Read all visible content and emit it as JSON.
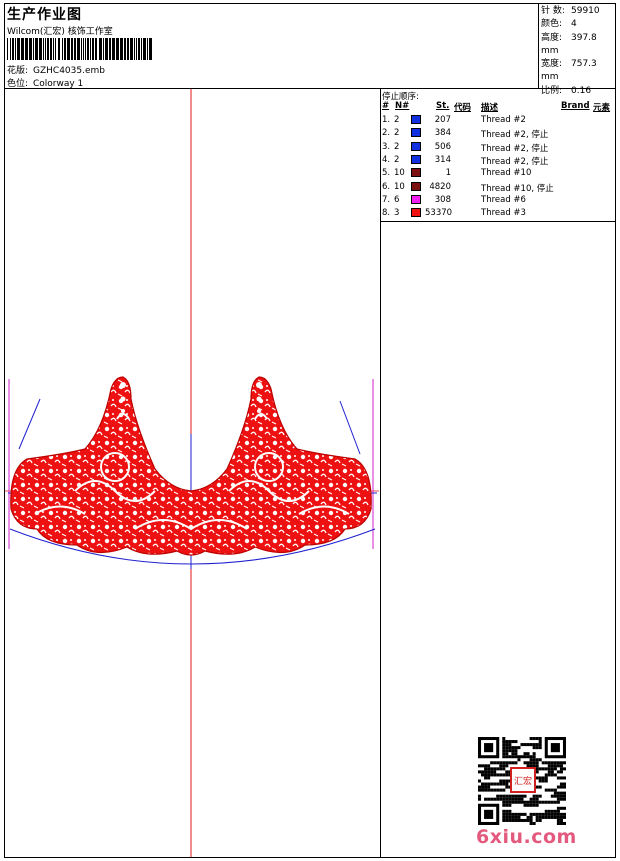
{
  "header": {
    "title": "生产作业图",
    "company": "Wilcom(汇宏) 核饰工作室",
    "design_label": "花版:",
    "design_value": "GZHC4035.emb",
    "colorway_label": "色位:",
    "colorway_value": "Colorway 1"
  },
  "stats": [
    {
      "label": "针 数:",
      "value": "59910"
    },
    {
      "label": "颜色:",
      "value": "4"
    },
    {
      "label": "高度:",
      "value": "397.8 mm"
    },
    {
      "label": "宽度:",
      "value": "757.3 mm"
    },
    {
      "label": "比例:",
      "value": "0.16"
    }
  ],
  "sequence": {
    "title": "停止顺序:",
    "headers": {
      "num": "#",
      "n": "N#",
      "st": "St.",
      "code": "代码",
      "desc": "描述",
      "brand": "Brand",
      "element": "元素"
    },
    "rows": [
      {
        "num": "1.",
        "n": "2",
        "color": "#1030e0",
        "st": "207",
        "desc": "Thread #2"
      },
      {
        "num": "2.",
        "n": "2",
        "color": "#1030e0",
        "st": "384",
        "desc": "Thread  #2, 停止"
      },
      {
        "num": "3.",
        "n": "2",
        "color": "#1030e0",
        "st": "506",
        "desc": "Thread  #2, 停止"
      },
      {
        "num": "4.",
        "n": "2",
        "color": "#1030e0",
        "st": "314",
        "desc": "Thread  #2, 停止"
      },
      {
        "num": "5.",
        "n": "10",
        "color": "#7a1010",
        "st": "1",
        "desc": "Thread #10"
      },
      {
        "num": "6.",
        "n": "10",
        "color": "#7a1010",
        "st": "4820",
        "desc": "Thread  #10, 停止"
      },
      {
        "num": "7.",
        "n": "6",
        "color": "#f020f0",
        "st": "308",
        "desc": "Thread #6"
      },
      {
        "num": "8.",
        "n": "3",
        "color": "#f01010",
        "st": "53370",
        "desc": "Thread #3"
      }
    ]
  },
  "colors": {
    "embroidery": "#ee1111",
    "guide_blue": "#2020d0",
    "axis_red": "#e01818",
    "guide_magenta": "#d020d0"
  },
  "watermark": "6xiu.com",
  "qr_seal_text": "汇宏"
}
